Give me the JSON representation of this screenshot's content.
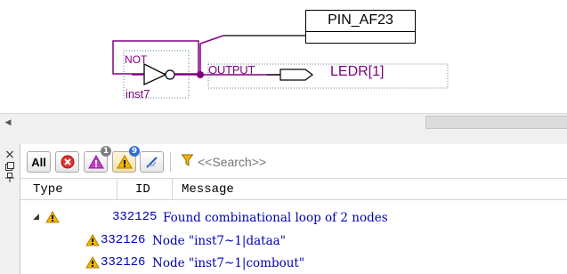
{
  "schematic": {
    "pin_name": "PIN_AF23",
    "gate_label": "NOT",
    "instance_name": "inst7",
    "port_label": "OUTPUT",
    "signal_name": "LEDR[1]",
    "wire_color": "#800080"
  },
  "scrollbar": {
    "left_arrow": "◀"
  },
  "dock_icons": {
    "close": "×",
    "float": "🗗",
    "pin": "🖈"
  },
  "toolbar": {
    "all_label": "All",
    "filters": [
      {
        "name": "error",
        "icon": "error-icon",
        "badge": ""
      },
      {
        "name": "critical-warning",
        "icon": "critical-warning-icon",
        "badge": "1"
      },
      {
        "name": "warning",
        "icon": "warning-icon",
        "badge": "9"
      },
      {
        "name": "suppressed",
        "icon": "flag-icon",
        "badge": ""
      }
    ],
    "search_placeholder": "<<Search>>"
  },
  "table": {
    "columns": [
      "Type",
      "ID",
      "Message"
    ],
    "rows": [
      {
        "type": "warning",
        "expanded": true,
        "id": "332125",
        "message": "Found combinational loop of 2 nodes"
      },
      {
        "type": "warning",
        "id": "332126",
        "message": "Node \"inst7~1|dataa\""
      },
      {
        "type": "warning",
        "id": "332126",
        "message": "Node \"inst7~1|combout\""
      }
    ]
  },
  "colors": {
    "message_text": "#0000b4",
    "warning_yellow": "#f2b705",
    "schematic_purple": "#800080"
  }
}
